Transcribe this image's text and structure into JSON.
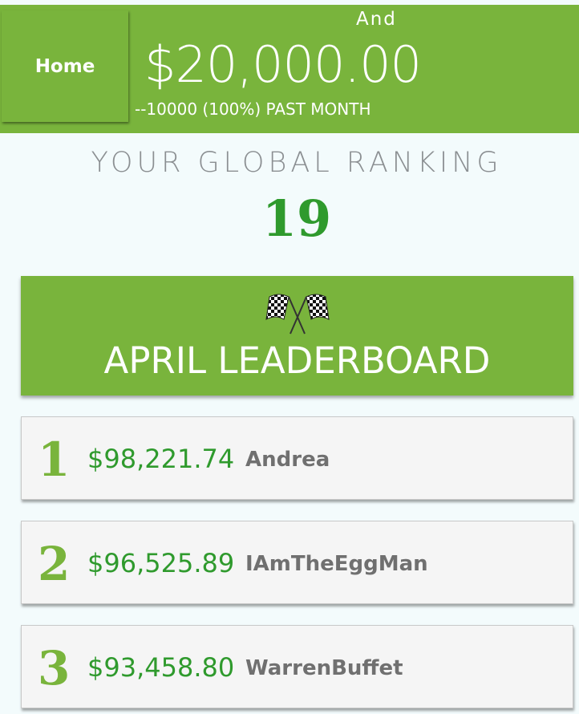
{
  "header": {
    "home_label": "Home",
    "user_name": "And",
    "balance": "$20,000.00",
    "change": "--10000 (100%) PAST MONTH",
    "background_color": "#79b43c"
  },
  "ranking": {
    "label": "YOUR GLOBAL RANKING",
    "value": "19"
  },
  "leaderboard": {
    "icon": "checkered-flags-icon",
    "title": "APRIL LEADERBOARD",
    "entries": [
      {
        "rank": "1",
        "amount": "$98,221.74",
        "name": "Andrea"
      },
      {
        "rank": "2",
        "amount": "$96,525.89",
        "name": "IAmTheEggMan"
      },
      {
        "rank": "3",
        "amount": "$93,458.80",
        "name": "WarrenBuffet"
      }
    ]
  },
  "colors": {
    "accent_green": "#79b43c",
    "amount_green": "#2f9a2d",
    "muted_gray": "#8b8f92"
  }
}
